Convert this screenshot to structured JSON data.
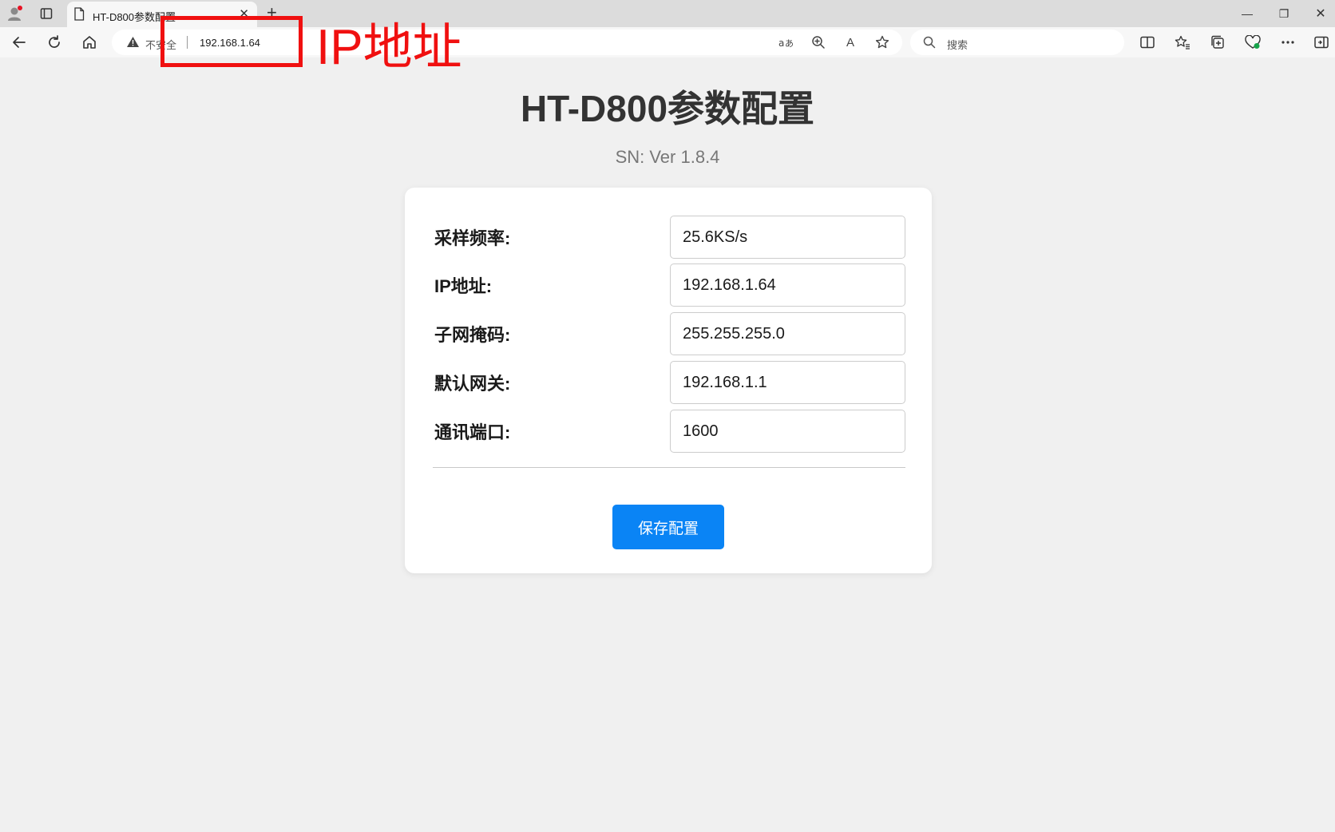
{
  "browser": {
    "tab_title": "HT-D800参数配置",
    "tab_close": "✕",
    "new_tab": "+",
    "insecure_label": "不安全",
    "url": "192.168.1.64",
    "search_placeholder": "搜索",
    "read_aloud_glyph": "A",
    "window_controls": {
      "minimize": "—",
      "restore": "❐",
      "close": "✕"
    },
    "profile_dot_color": "#e81123",
    "health_dot_color": "#16a34a"
  },
  "annotation": {
    "text": "IP地址",
    "color": "#f01010"
  },
  "page": {
    "title": "HT-D800参数配置",
    "subtitle": "SN: Ver 1.8.4"
  },
  "form": {
    "fields": [
      {
        "label": "采样频率:",
        "value": "25.6KS/s"
      },
      {
        "label": "IP地址:",
        "value": "192.168.1.64"
      },
      {
        "label": "子网掩码:",
        "value": "255.255.255.0"
      },
      {
        "label": "默认网关:",
        "value": "192.168.1.1"
      },
      {
        "label": "通讯端口:",
        "value": "1600"
      }
    ],
    "save_label": "保存配置",
    "save_color": "#0a84f5"
  }
}
